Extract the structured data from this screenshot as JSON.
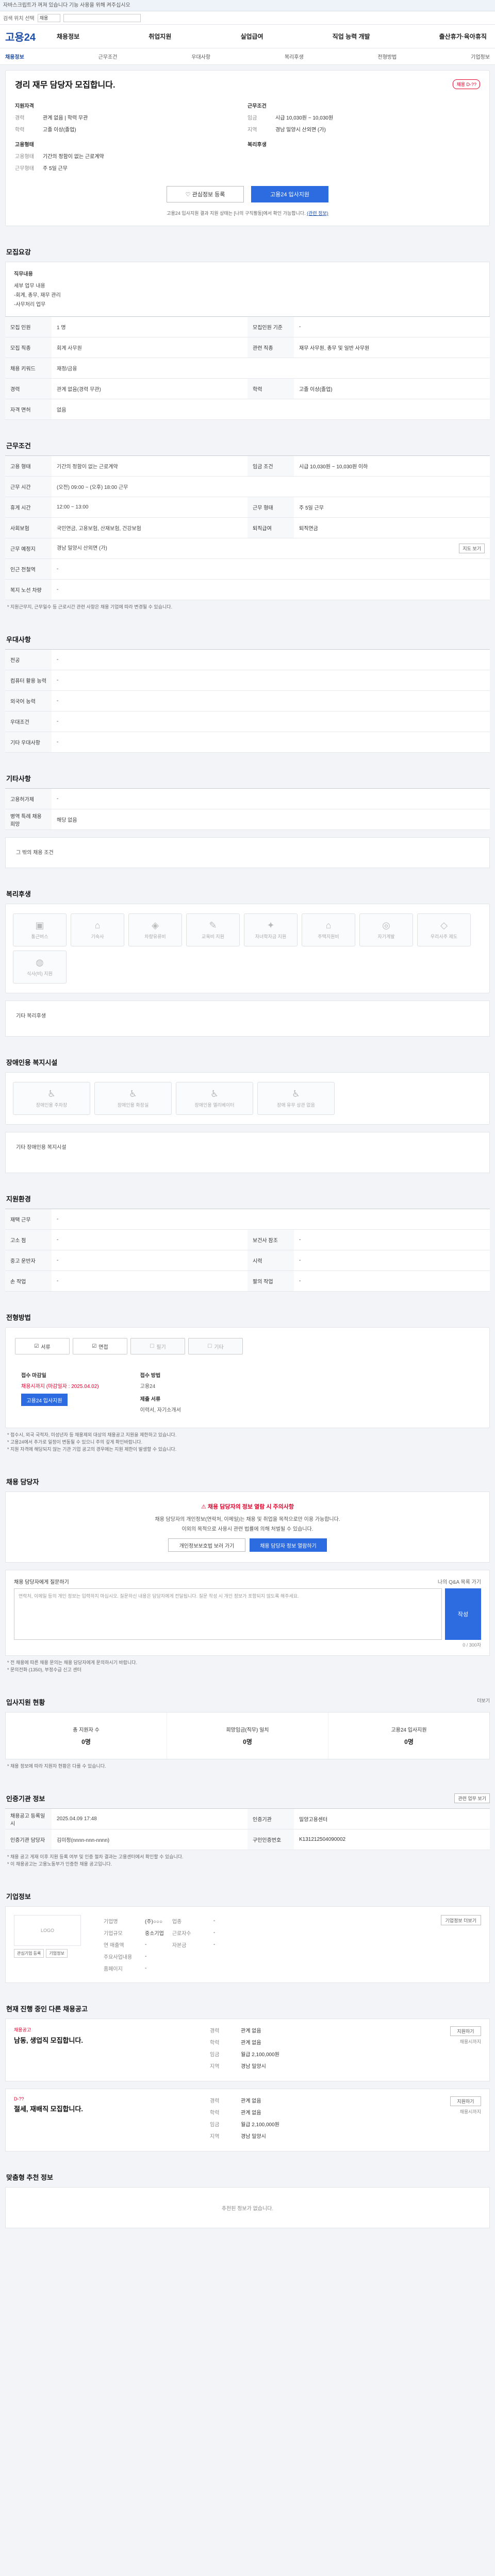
{
  "banner": "자바스크립트가 꺼져 있습니다 기능 사용을 위해 켜주십시오",
  "topbar": {
    "label": "검색 위치 선택",
    "sel": "채용"
  },
  "logo": "고용24",
  "gnb": [
    "채용정보",
    "취업지원",
    "실업급여",
    "직업 능력 개발",
    "출산휴가·육아휴직"
  ],
  "subnav": [
    "채용정보",
    "근무조건",
    "우대사항",
    "복리후생",
    "전형방법",
    "기업정보"
  ],
  "job": {
    "title": "경리 재무 담당자 모집합니다.",
    "badge": "채용 D-??",
    "company_h": "지원자격",
    "company": [
      [
        "경력",
        "관계 없음 | 학력 무관"
      ],
      [
        "학력",
        "고졸 이상(졸업)"
      ]
    ],
    "cond_h": "근무조건",
    "cond": [
      [
        "임금",
        "시급 10,030원 ~ 10,030원"
      ],
      [
        "지역",
        "경남 밀양시 산외면 (가)"
      ]
    ],
    "emp_h": "고용형태",
    "emp": [
      [
        "고용형태",
        "기간의 정함이 없는 근로계약"
      ],
      [
        "근무형태",
        "주 5일 근무"
      ]
    ],
    "welfare_h": "복리후생",
    "btn_scrap": "관심정보 등록",
    "btn_apply": "고용24 입사지원",
    "note": "고용24 입사지원 결과 지원 상태는 [나의 구직활동]에서 확인 가능합니다.",
    "note_link": "(관련 정보)"
  },
  "sec_apply": "모집요강",
  "apply_box": {
    "h": "직무내용",
    "lines": [
      "세부 업무 내용",
      "-회계, 총무, 재무 관리",
      "-사무처리 업무"
    ]
  },
  "apply_rows": [
    [
      "모집 인원",
      "1 명",
      "모집인원 기준",
      "-"
    ],
    [
      "모집 직종",
      "회계 사무원",
      "관련 직종",
      "재무 사무원, 총무 및 일반 사무원"
    ],
    [
      "채용 키워드",
      "재정/금융",
      "",
      ""
    ],
    [
      "경력",
      "관계 없음(경력 무관)",
      "학력",
      "고졸 이상(졸업)"
    ],
    [
      "자격 면허",
      "없음",
      "",
      ""
    ]
  ],
  "sec_cond": "근무조건",
  "cond_rows": [
    [
      "고용 형태",
      "기간의 정함이 없는 근로계약",
      "임금 조건",
      "시급 10,030원 ~ 10,030원 이하"
    ],
    [
      "근무 시간",
      "(오전) 09:00 ~ (오후) 18:00 근무",
      "",
      ""
    ],
    [
      "휴게 시간",
      "12:00 ~ 13:00",
      "근무 형태",
      "주 5일 근무"
    ],
    [
      "사회보험",
      "국민연금, 고용보험, 산재보험, 건강보험",
      "퇴직급여",
      "퇴직연금"
    ],
    [
      "근무 예정지",
      "경남 밀양시 산외면 (가)",
      "",
      ""
    ],
    [
      "인근 전철역",
      "-",
      "",
      ""
    ],
    [
      "복지 노선 차량",
      "-",
      "",
      ""
    ]
  ],
  "cond_map_btn": "지도 보기",
  "cond_note": "* 지원근무지, 근무일수 등 근로시간 관련 사항은 채용 기업에 따라 변경될 수 있습니다.",
  "sec_pref": "우대사항",
  "pref_rows": [
    [
      "전공",
      "-"
    ],
    [
      "컴퓨터 활용 능력",
      "-"
    ],
    [
      "외국어 능력",
      "-"
    ],
    [
      "우대조건",
      "-"
    ],
    [
      "기타 우대사항",
      "-"
    ]
  ],
  "sec_etc": "기타사항",
  "etc_rows": [
    [
      "고용허가제",
      "-"
    ],
    [
      "병역 특례 채용 희망",
      "해당 없음"
    ]
  ],
  "etc_box": "그 밖의 채용 조건",
  "sec_welfare": "복리후생",
  "welfare_icons": [
    "통근버스",
    "기숙사",
    "차량유류비",
    "교육비 지원",
    "자녀학자금 지원",
    "주택지원비",
    "자기계발",
    "우리사주 제도",
    "식사(비) 지원"
  ],
  "welfare_etc": "기타 복리후생",
  "sec_disab": "장애인용 복지시설",
  "disab_icons": [
    "장애인용 주차장",
    "장애인용 화장실",
    "장애인용 엘리베이터",
    "장애 유무 상관 없음"
  ],
  "disab_etc": "기타 장애인용 복지시설",
  "sec_screen": "지원환경",
  "screen_rows": [
    [
      "재택 근무",
      "-",
      "",
      ""
    ],
    [
      "고소 점",
      "-",
      "보건사 잠조",
      "-"
    ],
    [
      "중고 운반자",
      "-",
      "시력",
      "-"
    ],
    [
      "손 작업",
      "-",
      "팔의 작업",
      "-"
    ]
  ],
  "sec_method": "전형방법",
  "methods": [
    "서류",
    "면접",
    "필기",
    "기타"
  ],
  "recv": {
    "h1": "접수 마감일",
    "d1a": "채용시까지 (마감일자 : 2025.04.02)",
    "h2": "접수 방법",
    "d2a": "고용24",
    "h3": "",
    "d3": "",
    "h4": "제출 서류",
    "d4": "이력서, 자기소개서",
    "btn": "고용24 입사지원"
  },
  "method_notes": [
    "* 접수시, 외국 국적자, 미성년자 등 채용제외 대상의 채용공고 지원을 제한하고 있습니다.",
    "* 고용24에서 추가로 일정이 변동될 수 있으니 주의 깊게 확인바랍니다.",
    "* 지원 자격에 해당되지 않는 기관 기업 공고의 경우에는 지원 제한이 발생할 수 있습니다."
  ],
  "sec_contact": "채용 담당자",
  "alert": {
    "l1": "채용 담당자의 정보 열람 시 주의사항",
    "l2": "채용 담당자의 개인정보(연락처, 이메일)는 채용 및 취업을 목적으로만 이용 가능합니다.",
    "l3": "이외의 목적으로 사용시 관련 법률에 의해 처벌될 수 있습니다.",
    "b1": "개인정보보호법 보러 가기",
    "b2": "채용 담당자 정보 열람하기"
  },
  "qbox": {
    "h": "채용 담당자에게 질문하기",
    "r": "나의 Q&A 목록 가기",
    "ph": "연락처, 이메일 등의 개인 정보는 입력하지 마십시오. 질문하신 내용은 담당자에게 전달됩니다. 질문 작성 시 개인 정보가 포함되지 않도록 해주세요.",
    "send": "작성",
    "cnt": "0 / 300자"
  },
  "q_notes": [
    "* 전 채용에 따른 채용 문의는 채용 담당자에게 문의하시기 바랍니다.",
    "* 문의전화 (1350), 부정수급 신고 센터"
  ],
  "sec_stat": "입사지원 현황",
  "stat_more": "더보기",
  "stats": [
    [
      "총 지원자 수",
      "0명"
    ],
    [
      "희망임금(직무) 일치",
      "0명"
    ],
    [
      "고용24 입사지원",
      "0명"
    ]
  ],
  "stat_note": "* 채용 정보에 따라 지원자 현황은 다를 수 있습니다.",
  "sec_reg": "인증기관 정보",
  "reg_btn": "관련 업무 보기",
  "reg_rows": [
    [
      "채용공고 등록일시",
      "2025.04.09 17:48",
      "인증기관",
      "밀양고용센터"
    ],
    [
      "인증기관 담당자",
      "김미정(nnnn-nnn-nnnn)",
      "구인인증번호",
      "K131212504090002"
    ]
  ],
  "reg_notes": [
    "* 채용 공고 게재 이후 지원 등록 여부 및 인증 절차 결과는 고용센터에서 확인할 수 있습니다.",
    "* 이 채용공고는 고용노동부가 인증한 채용 공고입니다."
  ],
  "sec_co": "기업정보",
  "co": {
    "logo": "LOGO",
    "b1": "관심기업 등록",
    "b2": "기업정보",
    "rows": [
      [
        "기업명",
        "(주)○○○",
        "업종",
        "-"
      ],
      [
        "기업규모",
        "중소기업",
        "근로자수",
        "-"
      ],
      [
        "연 매출액",
        "-",
        "자본금",
        "-"
      ],
      [
        "주요사업내용",
        "-",
        "",
        ""
      ],
      [
        "홈페이지",
        "-",
        "",
        ""
      ]
    ],
    "more": "기업정보 더보기"
  },
  "sec_other": "현재 진행 중인 다른 채용공고",
  "others": [
    {
      "tag": "채용공고",
      "t": "남동, 생업직 모집합니다.",
      "rows": [
        [
          "경력",
          "관계 없음"
        ],
        [
          "학력",
          "관계 없음"
        ],
        [
          "임금",
          "월급 2,100,000원"
        ],
        [
          "지역",
          "경남 밀양시"
        ]
      ],
      "rb": "지원하기",
      "rs": "채용시까지"
    },
    {
      "tag": "D-??",
      "t": "절세, 재배직 모집합니다.",
      "rows": [
        [
          "경력",
          "관계 없음"
        ],
        [
          "학력",
          "관계 없음"
        ],
        [
          "임금",
          "월급 2,100,000원"
        ],
        [
          "지역",
          "경남 밀양시"
        ]
      ],
      "rb": "지원하기",
      "rs": "채용시까지"
    }
  ],
  "sec_reco": "맞춤형 추천 정보",
  "reco_empty": "추천된 정보가 없습니다."
}
